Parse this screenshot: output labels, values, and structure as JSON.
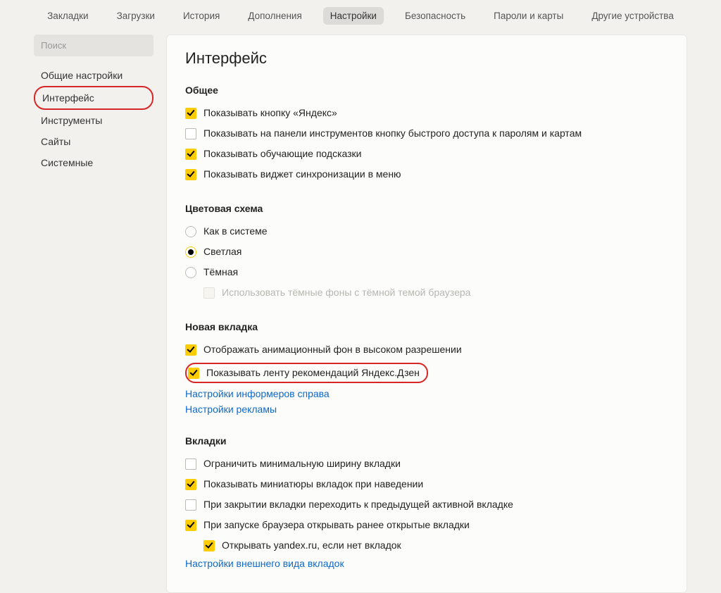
{
  "topnav": {
    "items": [
      "Закладки",
      "Загрузки",
      "История",
      "Дополнения",
      "Настройки",
      "Безопасность",
      "Пароли и карты",
      "Другие устройства"
    ],
    "active_index": 4
  },
  "sidebar": {
    "search_placeholder": "Поиск",
    "items": [
      "Общие настройки",
      "Интерфейс",
      "Инструменты",
      "Сайты",
      "Системные"
    ],
    "active_index": 1
  },
  "content": {
    "page_title": "Интерфейс",
    "general": {
      "title": "Общее",
      "opt_yandex_button": "Показывать кнопку «Яндекс»",
      "opt_passwords_quick": "Показывать на панели инструментов кнопку быстрого доступа к паролям и картам",
      "opt_hints": "Показывать обучающие подсказки",
      "opt_sync_widget": "Показывать виджет синхронизации в меню"
    },
    "color_scheme": {
      "title": "Цветовая схема",
      "opt_system": "Как в системе",
      "opt_light": "Светлая",
      "opt_dark": "Тёмная",
      "opt_dark_bg": "Использовать тёмные фоны с тёмной темой браузера"
    },
    "new_tab": {
      "title": "Новая вкладка",
      "opt_anim_bg": "Отображать анимационный фон в высоком разрешении",
      "opt_zen_feed": "Показывать ленту рекомендаций Яндекс.Дзен",
      "link_informers": "Настройки информеров справа",
      "link_ads": "Настройки рекламы"
    },
    "tabs": {
      "title": "Вкладки",
      "opt_min_width": "Ограничить минимальную ширину вкладки",
      "opt_thumbs": "Показывать миниатюры вкладок при наведении",
      "opt_prev_active": "При закрытии вкладки переходить к предыдущей активной вкладке",
      "opt_restore": "При запуске браузера открывать ранее открытые вкладки",
      "opt_open_yandex": "Открывать yandex.ru, если нет вкладок",
      "link_appearance": "Настройки внешнего вида вкладок"
    }
  }
}
